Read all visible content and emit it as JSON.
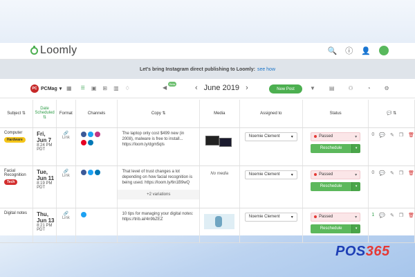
{
  "app": {
    "name": "Loomly"
  },
  "banner": {
    "text": "Let's bring Instagram direct publishing to Loomly:",
    "link": "see how"
  },
  "toolbar": {
    "calendar": "PCMag",
    "month": "June 2019",
    "new_post": "New Post",
    "beta": "Beta"
  },
  "columns": [
    "Subject",
    "Date Scheduled",
    "Format",
    "Channels",
    "Copy",
    "Media",
    "Assigned to",
    "Status"
  ],
  "rows": [
    {
      "subject": "Computer",
      "tag": "Hardware",
      "tag_color": "#f5c518",
      "day": "Fri, Jun 7",
      "time": "8:24 PM",
      "tz": "PDT",
      "format": "Link",
      "copy": "The laptop only cost $499 new (in 2008), malware is free to install... https://loom.ly/dgm5qls",
      "media": "",
      "assignee": "Noemie Clement",
      "status": "Passed",
      "action": "Reschedule",
      "comments": "0",
      "variations": ""
    },
    {
      "subject": "Facial Recognition",
      "tag": "Tech",
      "tag_color": "#d32f2f",
      "day": "Tue, Jun 11",
      "time": "8:19 PM",
      "tz": "PDT",
      "format": "Link",
      "copy": "That level of trust changes a lot depending on how facial recognition is being used. https://loom.ly/6n1B9wQ",
      "media": "No media",
      "assignee": "Noemie Clement",
      "status": "Passed",
      "action": "Reschedule",
      "comments": "0",
      "variations": "+2 variations"
    },
    {
      "subject": "Digital notes",
      "tag": "",
      "tag_color": "",
      "day": "Thu, Jun 13",
      "time": "8:21 PM",
      "tz": "PDT",
      "format": "Link",
      "copy": "10 tips for managing your digital notes: https://trib.al/4n9bZEZ",
      "media": "",
      "assignee": "Noemie Clement",
      "status": "Passed",
      "action": "Reschedule",
      "comments": "1",
      "variations": ""
    }
  ],
  "brand": {
    "a": "POS",
    "b": "365"
  }
}
